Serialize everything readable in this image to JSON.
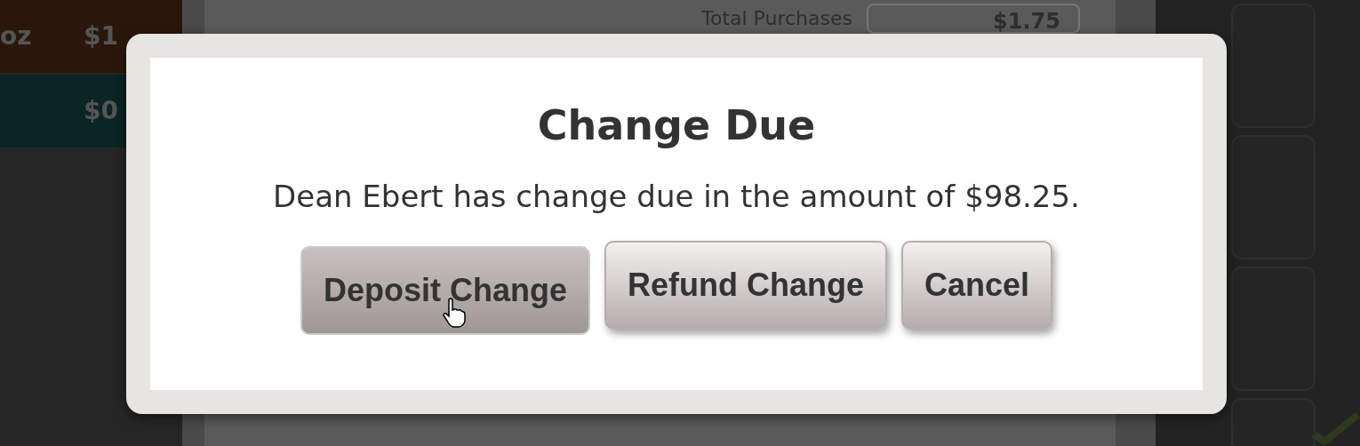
{
  "background": {
    "items": [
      {
        "name": "oz",
        "price": "$1",
        "color": "#2a170b"
      },
      {
        "price": "$0",
        "color": "#0b2424"
      }
    ],
    "total_label": "Total Purchases",
    "total_amount": "$1.75"
  },
  "dialog": {
    "title": "Change Due",
    "message": "Dean Ebert has change due in the amount of $98.25.",
    "buttons": [
      {
        "label": "Deposit Change",
        "pressed": true
      },
      {
        "label": "Refund Change",
        "pressed": false
      },
      {
        "label": "Cancel",
        "pressed": false
      }
    ]
  }
}
